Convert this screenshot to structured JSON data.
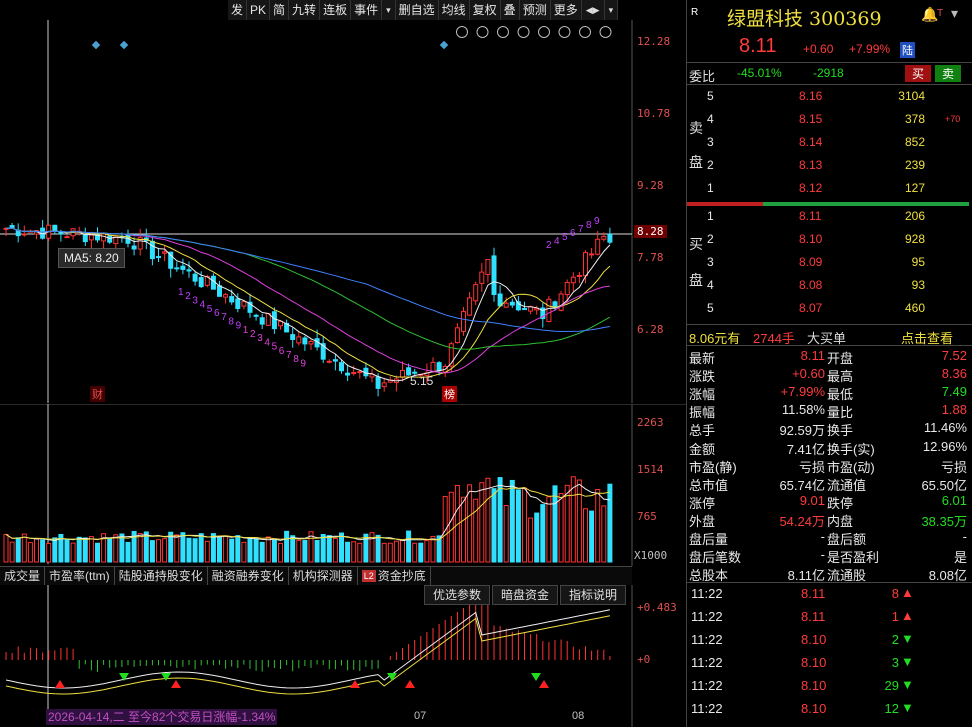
{
  "toolbar": {
    "items": [
      "发",
      "PK",
      "简",
      "九转",
      "连板",
      "事件",
      "▾",
      "删自选",
      "均线",
      "复权",
      "叠",
      "预测",
      "更多",
      "◀▶",
      "▾"
    ]
  },
  "main_chart": {
    "price_axis": [
      "12.28",
      "10.78",
      "9.28",
      "8.28",
      "7.78",
      "6.28"
    ],
    "tooltip": "MA5: 8.20",
    "low_label": "5.15",
    "markers": [
      "财",
      "榜"
    ],
    "countdown_digits_a": [
      "1",
      "2",
      "3",
      "4",
      "5",
      "6",
      "7",
      "8",
      "9",
      "1",
      "2",
      "3",
      "4",
      "5",
      "6",
      "7",
      "8",
      "9"
    ],
    "countdown_digits_b": [
      "2",
      "4",
      "5",
      "6",
      "7",
      "8",
      "9"
    ]
  },
  "volume_axis": [
    "2263",
    "1514",
    "765",
    "X1000"
  ],
  "tabs": [
    "成交量",
    "市盈率(ttm)",
    "陆股通持股变化",
    "融资融券变化",
    "机构探测器",
    "资金抄底"
  ],
  "tab_badge": "L2",
  "sub_buttons": [
    "优选参数",
    "暗盘资金",
    "指标说明"
  ],
  "macd_axis": [
    "+0.483",
    "+0"
  ],
  "date_axis": [
    "07",
    "08"
  ],
  "status_text": "2026-04-14,二 至今82个交易日涨幅-1.34%",
  "quote": {
    "r_badge": "R",
    "name": "绿盟科技 300369",
    "price": "8.11",
    "change": "+0.60",
    "change_pct": "+7.99%",
    "market_tag": "陆",
    "weibi_label": "委比",
    "weibi_pct": "-45.01%",
    "weibi_diff": "-2918",
    "buy_btn": "买",
    "sell_btn": "卖"
  },
  "sell_side_label": [
    "卖",
    "盘"
  ],
  "buy_side_label": [
    "买",
    "盘"
  ],
  "asks": [
    {
      "lvl": "5",
      "price": "8.16",
      "vol": "3104",
      "chg": ""
    },
    {
      "lvl": "4",
      "price": "8.15",
      "vol": "378",
      "chg": "+70"
    },
    {
      "lvl": "3",
      "price": "8.14",
      "vol": "852",
      "chg": ""
    },
    {
      "lvl": "2",
      "price": "8.13",
      "vol": "239",
      "chg": ""
    },
    {
      "lvl": "1",
      "price": "8.12",
      "vol": "127",
      "chg": ""
    }
  ],
  "bids": [
    {
      "lvl": "1",
      "price": "8.11",
      "vol": "206"
    },
    {
      "lvl": "2",
      "price": "8.10",
      "vol": "928"
    },
    {
      "lvl": "3",
      "price": "8.09",
      "vol": "95"
    },
    {
      "lvl": "4",
      "price": "8.08",
      "vol": "93"
    },
    {
      "lvl": "5",
      "price": "8.07",
      "vol": "460"
    }
  ],
  "big_order": {
    "amount": "8.06元有",
    "vol": "2744手",
    "label": "大买单",
    "link": "点击查看"
  },
  "stats": [
    {
      "k1": "最新",
      "v1": "8.11",
      "c1": "red",
      "k2": "开盘",
      "v2": "7.52",
      "c2": "red"
    },
    {
      "k1": "涨跌",
      "v1": "+0.60",
      "c1": "red",
      "k2": "最高",
      "v2": "8.36",
      "c2": "red"
    },
    {
      "k1": "涨幅",
      "v1": "+7.99%",
      "c1": "red",
      "k2": "最低",
      "v2": "7.49",
      "c2": "grn"
    },
    {
      "k1": "振幅",
      "v1": "11.58%",
      "c1": "wht",
      "k2": "量比",
      "v2": "1.88",
      "c2": "red"
    },
    {
      "k1": "总手",
      "v1": "92.59万",
      "c1": "wht",
      "k2": "换手",
      "v2": "11.46%",
      "c2": "wht"
    },
    {
      "k1": "金额",
      "v1": "7.41亿",
      "c1": "wht",
      "k2": "换手(实)",
      "v2": "12.96%",
      "c2": "wht"
    },
    {
      "k1": "市盈(静)",
      "v1": "亏损",
      "c1": "wht",
      "k2": "市盈(动)",
      "v2": "亏损",
      "c2": "wht"
    },
    {
      "k1": "总市值",
      "v1": "65.74亿",
      "c1": "wht",
      "k2": "流通值",
      "v2": "65.50亿",
      "c2": "wht"
    },
    {
      "k1": "涨停",
      "v1": "9.01",
      "c1": "red",
      "k2": "跌停",
      "v2": "6.01",
      "c2": "grn"
    },
    {
      "k1": "外盘",
      "v1": "54.24万",
      "c1": "red",
      "k2": "内盘",
      "v2": "38.35万",
      "c2": "grn"
    },
    {
      "k1": "盘后量",
      "v1": "-",
      "c1": "wht",
      "k2": "盘后额",
      "v2": "-",
      "c2": "wht"
    },
    {
      "k1": "盘后笔数",
      "v1": "-",
      "c1": "wht",
      "k2": "是否盈利",
      "v2": "是",
      "c2": "wht"
    },
    {
      "k1": "总股本",
      "v1": "8.11亿",
      "c1": "wht",
      "k2": "流通股",
      "v2": "8.08亿",
      "c2": "wht"
    }
  ],
  "ticks": [
    {
      "time": "11:22",
      "price": "8.11",
      "vol": "8",
      "dir": "up"
    },
    {
      "time": "11:22",
      "price": "8.11",
      "vol": "1",
      "dir": "up"
    },
    {
      "time": "11:22",
      "price": "8.10",
      "vol": "2",
      "dir": "down"
    },
    {
      "time": "11:22",
      "price": "8.10",
      "vol": "3",
      "dir": "down"
    },
    {
      "time": "11:22",
      "price": "8.10",
      "vol": "29",
      "dir": "down"
    },
    {
      "time": "11:22",
      "price": "8.10",
      "vol": "12",
      "dir": "down"
    }
  ]
}
